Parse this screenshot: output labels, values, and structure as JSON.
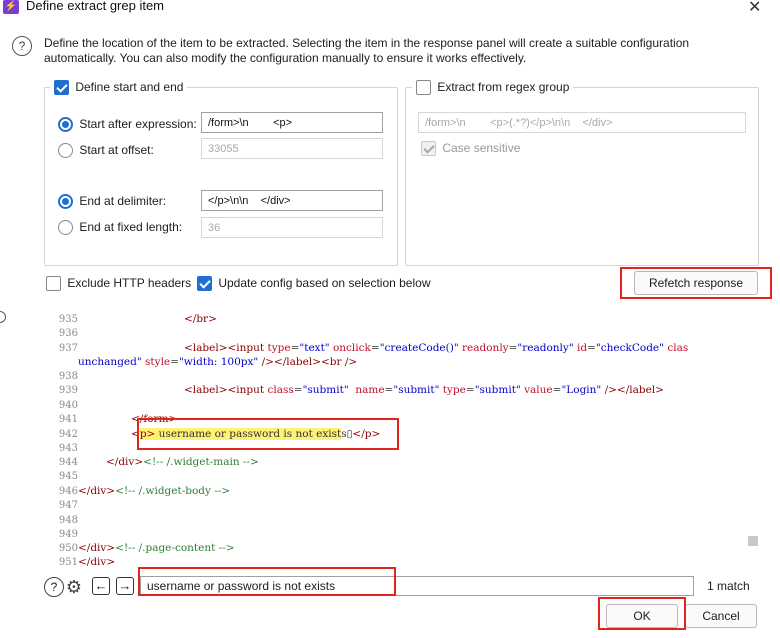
{
  "window": {
    "title": "Define extract grep item",
    "app_icon": "burp-icon"
  },
  "description": "Define the location of the item to be extracted. Selecting the item in the response panel will create a suitable configuration automatically. You can also modify the configuration manually to ensure it works effectively.",
  "left_group": {
    "legend": "Define start and end",
    "legend_checked": true,
    "start_after_label": "Start after expression:",
    "start_after_value": "/form>\\n        <p>",
    "start_offset_label": "Start at offset:",
    "start_offset_value": "33055",
    "end_delim_label": "End at delimiter:",
    "end_delim_value": "</p>\\n\\n    </div>",
    "end_fixed_label": "End at fixed length:",
    "end_fixed_value": "36"
  },
  "right_group": {
    "legend": "Extract from regex group",
    "legend_checked": false,
    "regex_value": "/form>\\n        <p>(.*?)</p>\\n\\n    </div>",
    "case_label": "Case sensitive",
    "case_checked": true
  },
  "options": {
    "exclude_headers_label": "Exclude HTTP headers",
    "update_config_label": "Update config based on selection below"
  },
  "refetch_label": "Refetch response",
  "code_lines": [
    "935",
    "936",
    "937",
    "",
    "938",
    "939",
    "940",
    "941",
    "942",
    "943",
    "944",
    "945",
    "946",
    "947",
    "948",
    "949",
    "950",
    "951"
  ],
  "search": {
    "value": "username or password is not exists",
    "match_count": "1 match"
  },
  "buttons": {
    "ok": "OK",
    "cancel": "Cancel"
  },
  "colors": {
    "accent": "#1f6fd1",
    "highlight": "#fff176",
    "annotation_red": "#e0261b"
  }
}
